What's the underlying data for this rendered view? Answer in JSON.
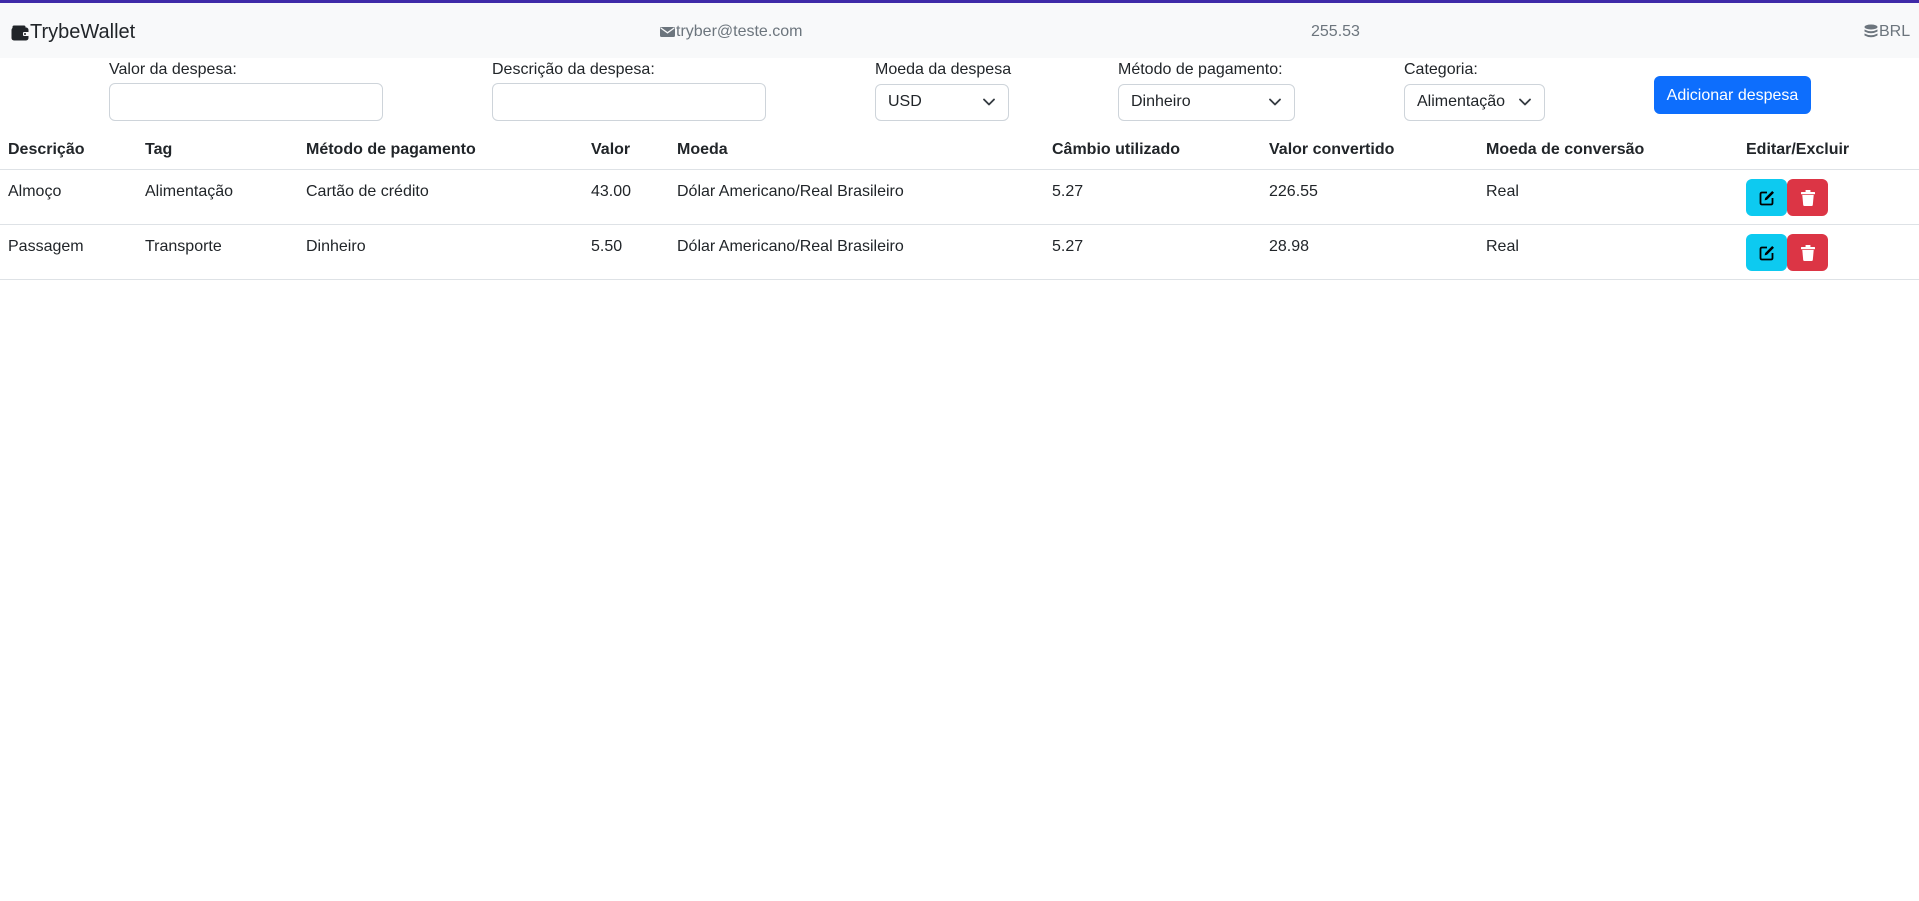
{
  "header": {
    "brand": "TrybeWallet",
    "email": "tryber@teste.com",
    "total": "255.53",
    "currency": "BRL"
  },
  "form": {
    "value_label": "Valor da despesa:",
    "description_label": "Descrição da despesa:",
    "currency_label": "Moeda da despesa",
    "currency_selected": "USD",
    "method_label": "Método de pagamento:",
    "method_selected": "Dinheiro",
    "category_label": "Categoria:",
    "category_selected": "Alimentação",
    "add_button": "Adicionar despesa"
  },
  "table": {
    "headers": [
      "Descrição",
      "Tag",
      "Método de pagamento",
      "Valor",
      "Moeda",
      "Câmbio utilizado",
      "Valor convertido",
      "Moeda de conversão",
      "Editar/Excluir"
    ],
    "rows": [
      {
        "description": "Almoço",
        "tag": "Alimentação",
        "method": "Cartão de crédito",
        "value": "43.00",
        "currency": "Dólar Americano/Real Brasileiro",
        "rate": "5.27",
        "converted": "226.55",
        "conversion_currency": "Real"
      },
      {
        "description": "Passagem",
        "tag": "Transporte",
        "method": "Dinheiro",
        "value": "5.50",
        "currency": "Dólar Americano/Real Brasileiro",
        "rate": "5.27",
        "converted": "28.98",
        "conversion_currency": "Real"
      }
    ]
  },
  "icons": {
    "brand": "wallet-icon",
    "email": "envelope-icon",
    "currency": "coins-icon",
    "select": "chevron-down-icon",
    "edit": "edit-icon",
    "delete": "trash-icon"
  },
  "colors": {
    "header_bg": "#f8f9fa",
    "header_accent": "#3f2aa8",
    "primary": "#0d6efd",
    "info": "#0dcaf0",
    "danger": "#dc3545"
  }
}
